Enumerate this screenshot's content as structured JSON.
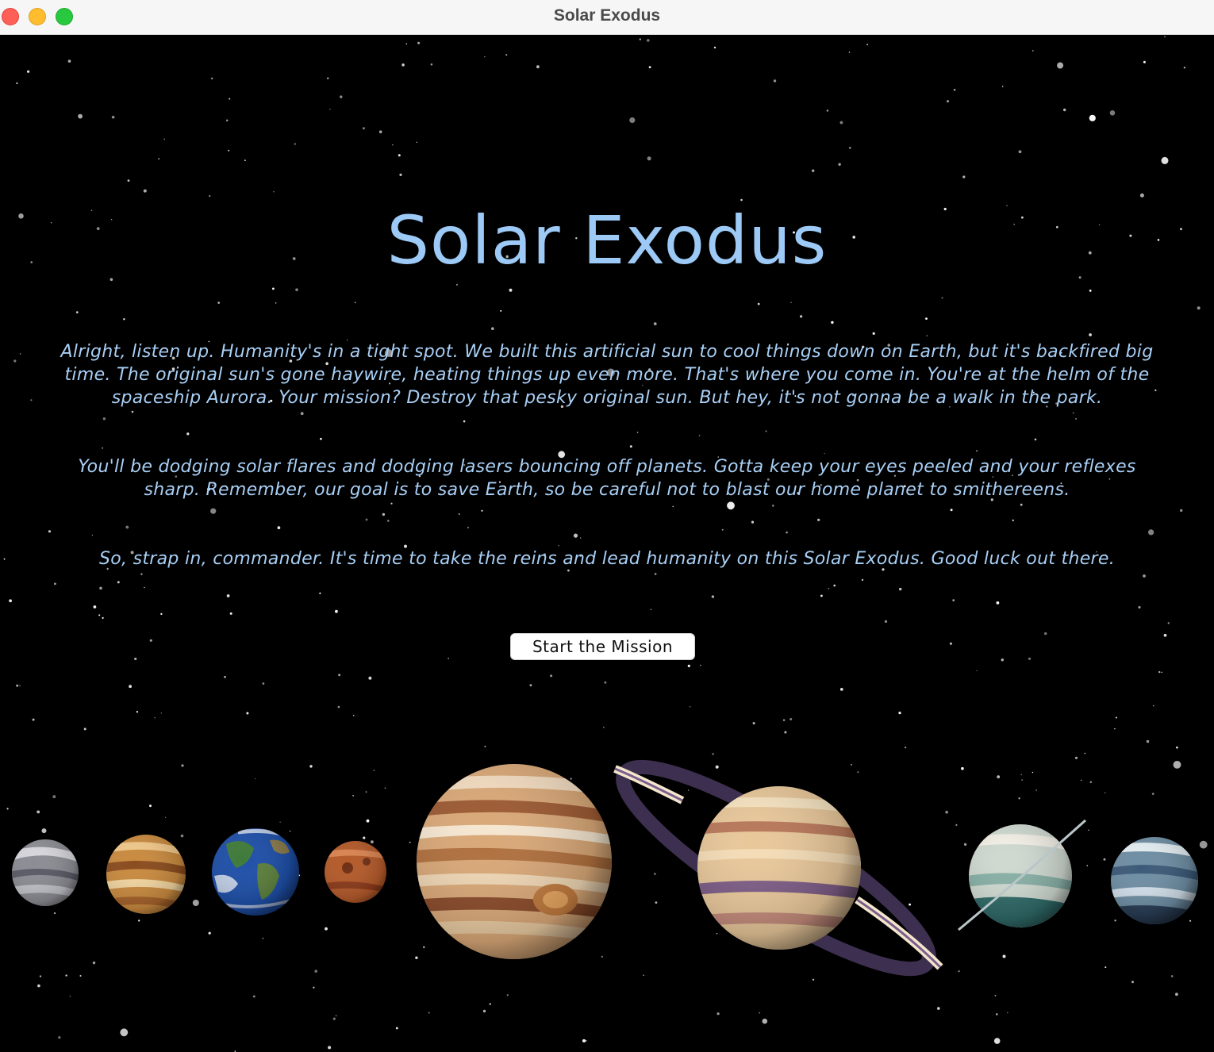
{
  "window": {
    "title": "Solar Exodus"
  },
  "screen": {
    "title": "Solar Exodus",
    "paragraphs": [
      "Alright, listen up. Humanity's in a tight spot. We built this artificial sun to cool things down on Earth, but it's backfired big time. The original sun's gone haywire, heating things up even more. That's where you come in. You're at the helm of the spaceship Aurora. Your mission? Destroy that pesky original sun. But hey, it's not gonna be a walk in the park.",
      "You'll be dodging solar flares and dodging lasers bouncing off planets. Gotta keep your eyes peeled and your reflexes sharp. Remember, our goal is to save Earth, so be careful not to blast our home planet to smithereens.",
      "So, strap in, commander. It's time to take the reins and lead humanity on this Solar Exodus. Good luck out there."
    ],
    "start_button_label": "Start the Mission"
  },
  "planets": [
    "mercury",
    "venus",
    "earth",
    "mars",
    "jupiter",
    "saturn",
    "uranus",
    "neptune"
  ],
  "colors": {
    "background": "#000000",
    "title_text": "#9cc9f5",
    "body_text": "#a8cff5",
    "button_bg": "#ffffff"
  }
}
